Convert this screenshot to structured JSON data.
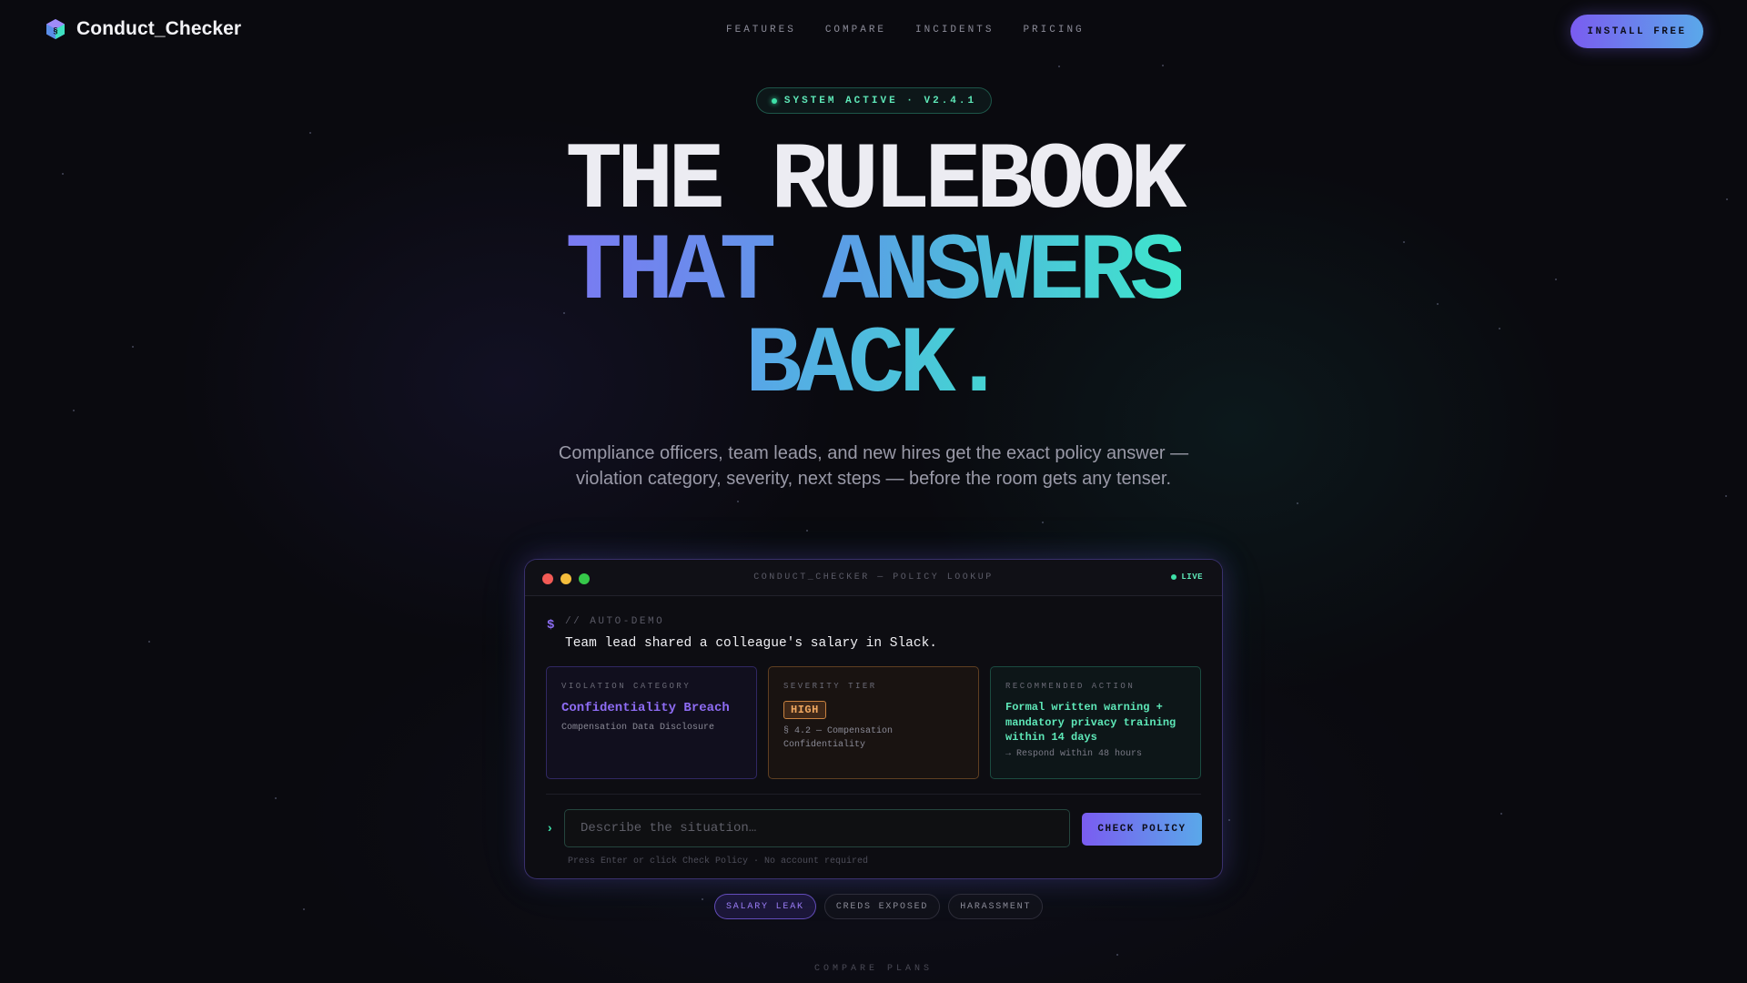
{
  "brand": {
    "name": "Conduct_Checker"
  },
  "nav": {
    "links": [
      "FEATURES",
      "COMPARE",
      "INCIDENTS",
      "PRICING"
    ],
    "cta": "INSTALL FREE"
  },
  "badge": {
    "text": "SYSTEM ACTIVE · V2.4.1"
  },
  "hero": {
    "line1": "THE RULEBOOK",
    "line2": "THAT ANSWERS",
    "line3": "BACK.",
    "subtitle": "Compliance officers, team leads, and new hires get the exact policy answer — violation category, severity, next steps — before the room gets any tenser."
  },
  "terminal": {
    "title": "CONDUCT_CHECKER — POLICY LOOKUP",
    "live": "LIVE",
    "prompt_symbol": "$",
    "demo_label": "// AUTO-DEMO",
    "demo_text": "Team lead shared a colleague's salary in Slack.",
    "cards": {
      "category": {
        "label": "VIOLATION CATEGORY",
        "value": "Confidentiality Breach",
        "detail": "Compensation Data Disclosure"
      },
      "severity": {
        "label": "SEVERITY TIER",
        "value": "HIGH",
        "detail": "§ 4.2 — Compensation Confidentiality"
      },
      "action": {
        "label": "RECOMMENDED ACTION",
        "value": "Formal written warning + mandatory privacy training within 14 days",
        "detail": "→ Respond within 48 hours"
      }
    },
    "input": {
      "arrow": "›",
      "placeholder": "Describe the situation…",
      "value": ""
    },
    "submit": "CHECK POLICY",
    "hint": "Press Enter or click Check Policy · No account required"
  },
  "chips": [
    "SALARY LEAK",
    "CREDS EXPOSED",
    "HARASSMENT"
  ],
  "active_chip": "SALARY LEAK",
  "footer_label": "COMPARE PLANS",
  "colors": {
    "accent_purple": "#7a5cf0",
    "accent_blue": "#5aa8ea",
    "accent_teal": "#3ee0a8",
    "severity_orange": "#f0a860",
    "background": "#0a0a0f"
  }
}
